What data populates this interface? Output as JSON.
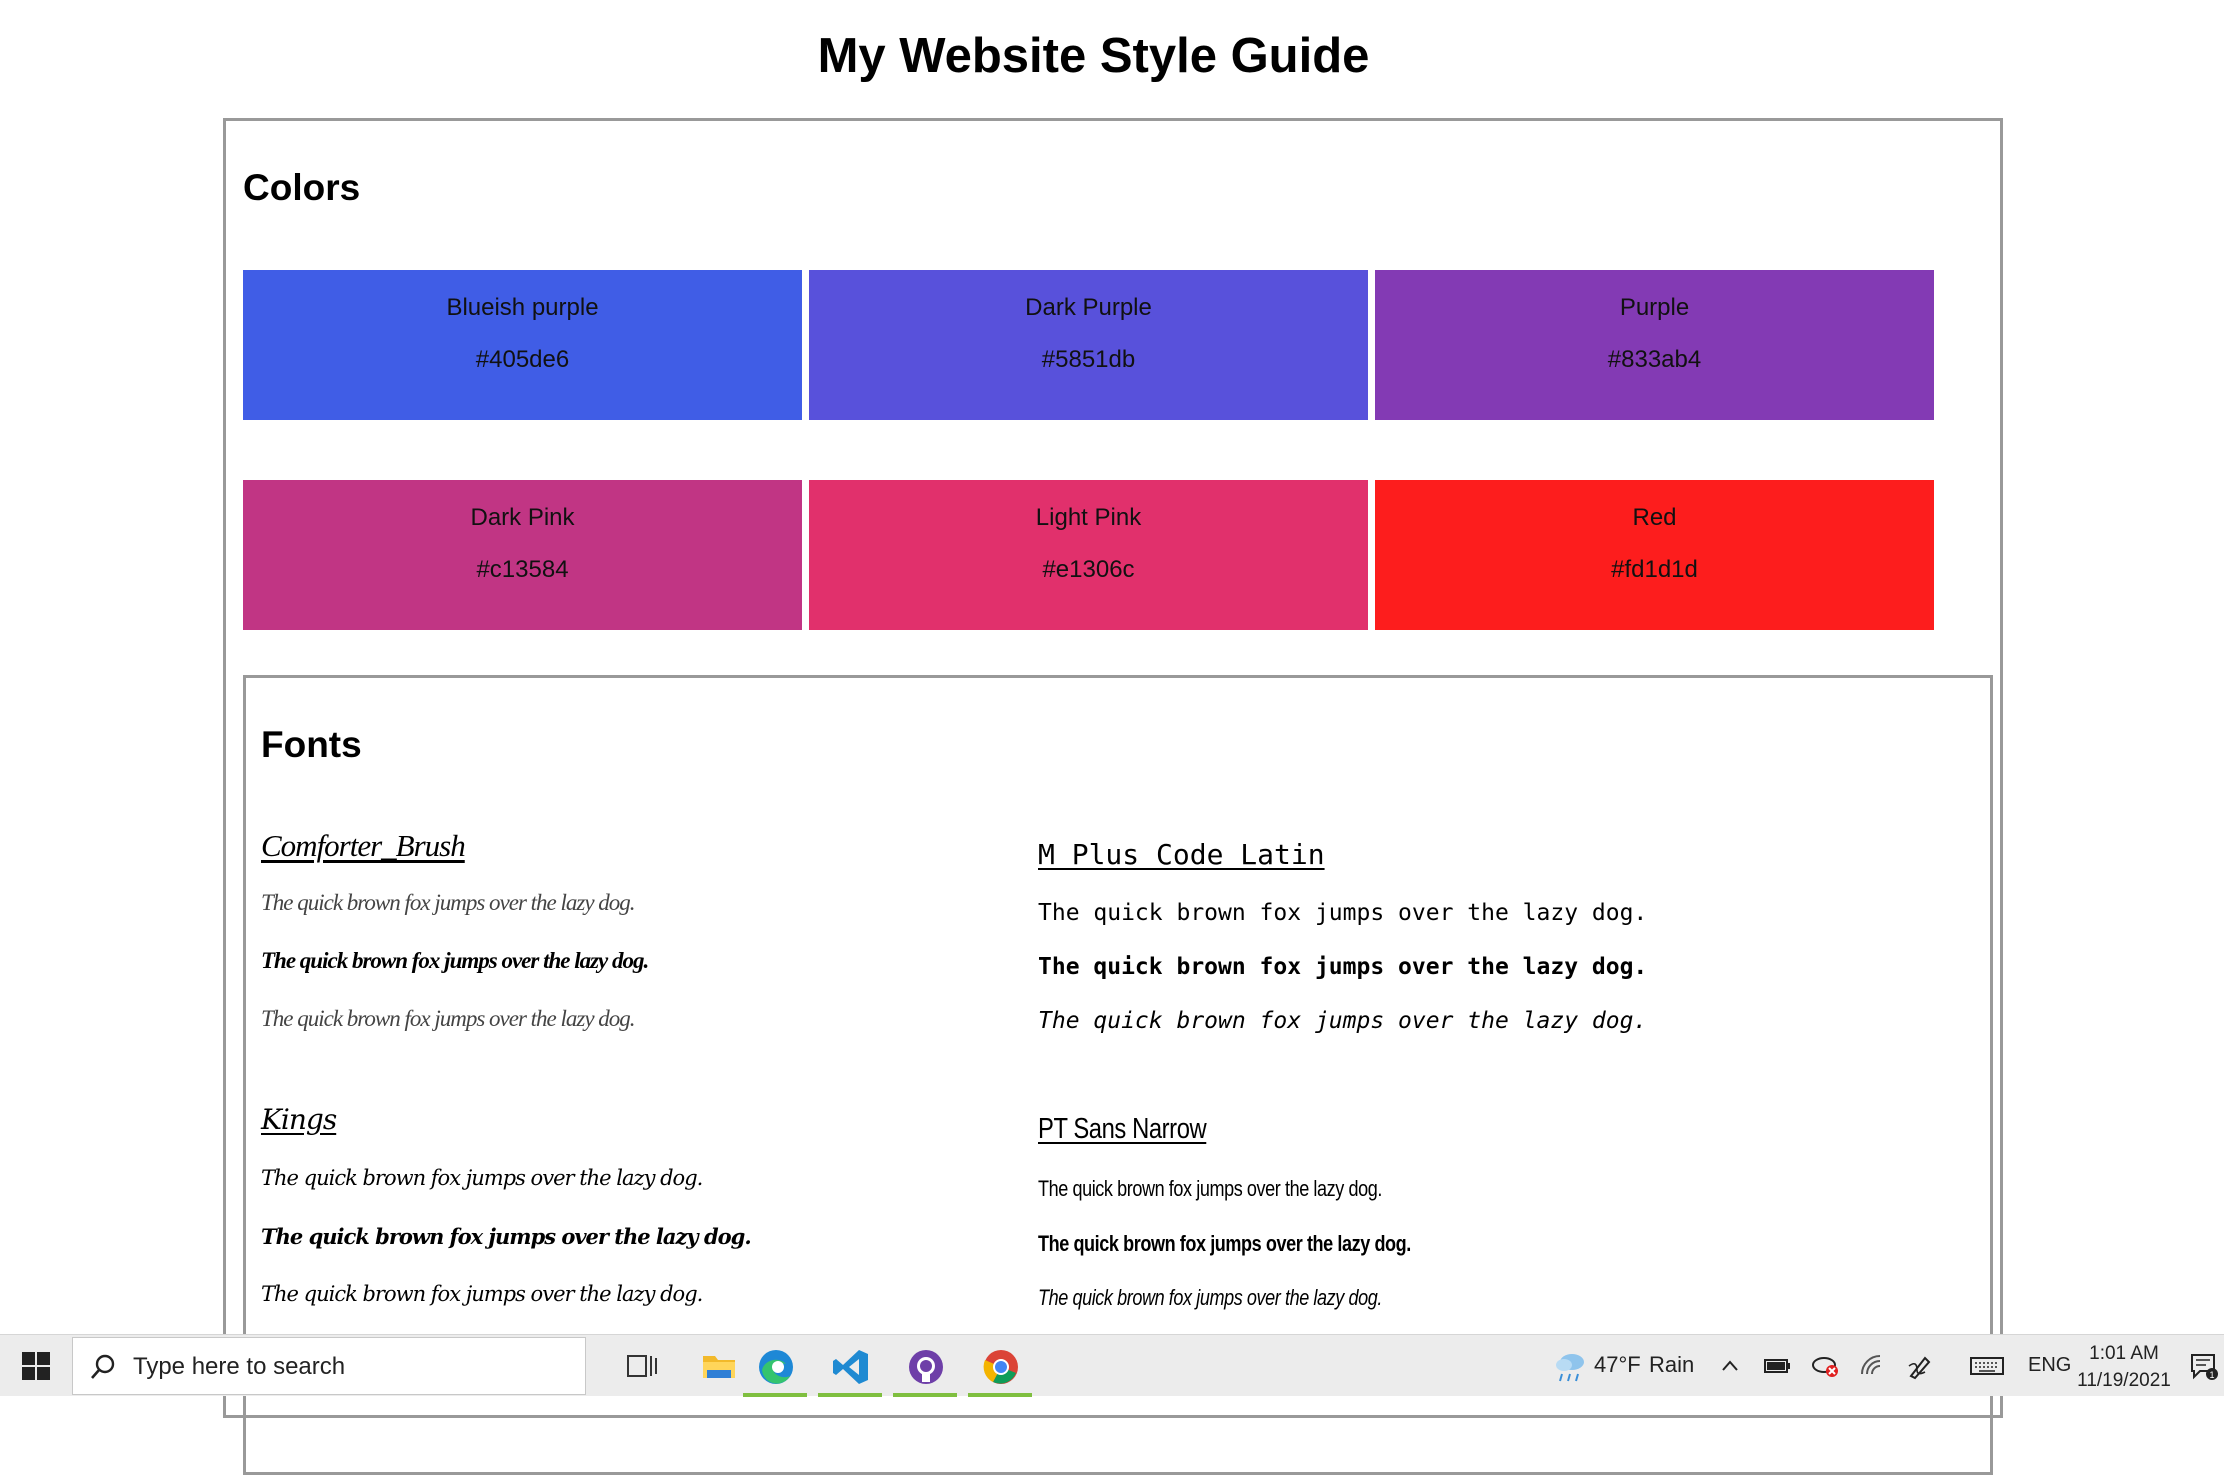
{
  "page": {
    "title": "My Website Style Guide"
  },
  "colors": {
    "title": "Colors",
    "swatches": [
      {
        "name": "Blueish purple",
        "hex": "#405de6"
      },
      {
        "name": "Dark Purple",
        "hex": "#5851db"
      },
      {
        "name": "Purple",
        "hex": "#833ab4"
      },
      {
        "name": "Dark Pink",
        "hex": "#c13584"
      },
      {
        "name": "Light Pink",
        "hex": "#e1306c"
      },
      {
        "name": "Red",
        "hex": "#fd1d1d"
      }
    ]
  },
  "fonts": {
    "title": "Fonts",
    "sample_text": "The quick brown fox jumps over the lazy dog.",
    "families": [
      {
        "name": "Comforter_Brush"
      },
      {
        "name": "M Plus Code Latin"
      },
      {
        "name": "Kings"
      },
      {
        "name": "PT Sans Narrow"
      }
    ]
  },
  "taskbar": {
    "search_placeholder": "Type here to search",
    "apps": [
      "task-view-icon",
      "file-explorer-icon",
      "edge-icon",
      "vscode-icon",
      "github-desktop-icon",
      "chrome-icon"
    ],
    "weather_temp": "47°F",
    "weather_cond": "Rain",
    "language": "ENG",
    "time": "1:01 AM",
    "date": "11/19/2021",
    "notification_count": "1"
  }
}
